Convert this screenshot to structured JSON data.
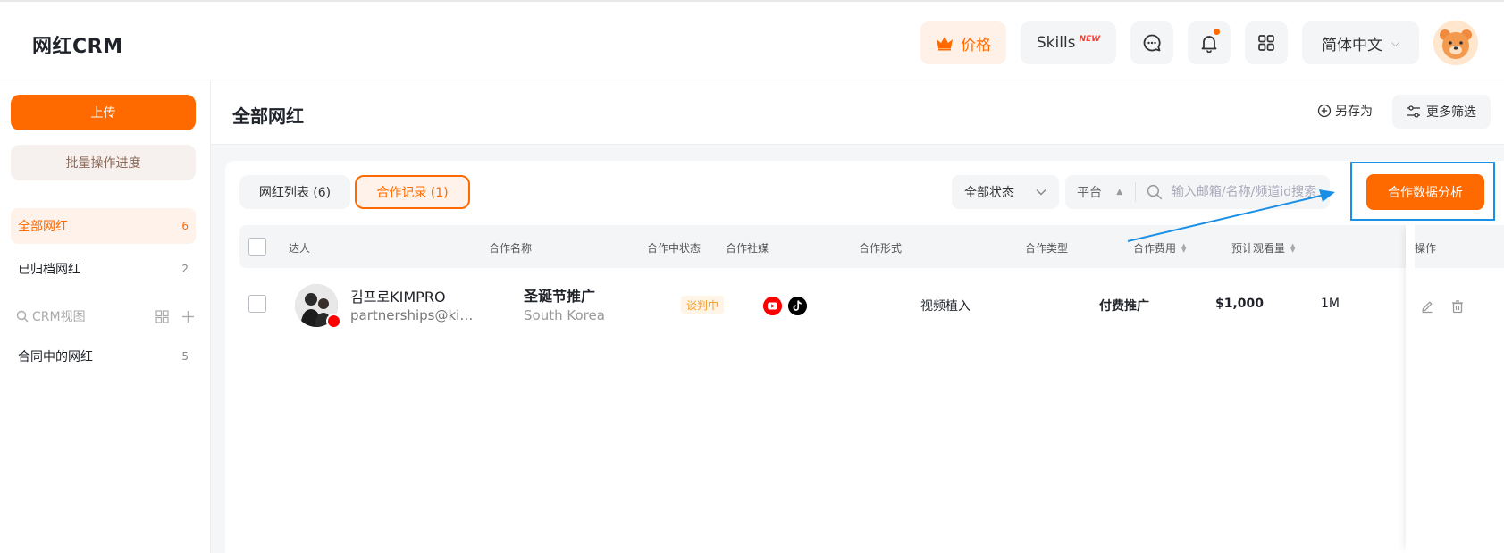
{
  "app": {
    "title": "网红CRM"
  },
  "topbar": {
    "price_label": "价格",
    "skills_label": "Skills",
    "skills_badge": "NEW",
    "language": "简体中文"
  },
  "sidebar": {
    "upload_label": "上传",
    "batch_label": "批量操作进度",
    "items": [
      {
        "label": "全部网红",
        "count": "6"
      },
      {
        "label": "已归档网红",
        "count": "2"
      }
    ],
    "view_label": "CRM视图",
    "view_items": [
      {
        "label": "合同中的网红",
        "count": "5"
      }
    ]
  },
  "main": {
    "page_title": "全部网红",
    "save_as": "另存为",
    "more_filters": "更多筛选",
    "tabs": [
      {
        "label": "网红列表 (6)"
      },
      {
        "label": "合作记录 (1)"
      }
    ],
    "status_filter": "全部状态",
    "platform_filter": "平台",
    "search_placeholder": "输入邮箱/名称/频道id搜索",
    "analysis_button": "合作数据分析"
  },
  "table": {
    "columns": [
      "达人",
      "合作名称",
      "合作中状态",
      "合作社媒",
      "合作形式",
      "合作类型",
      "合作费用",
      "预计观看量",
      "操作"
    ],
    "rows": [
      {
        "name": "김프로KIMPRO",
        "email": "partnerships@kimpro.com",
        "coop_name": "圣诞节推广",
        "region": "South Korea",
        "status": "谈判中",
        "format": "视频植入",
        "type": "付费推广",
        "fee": "$1,000",
        "views": "1M"
      }
    ]
  },
  "colors": {
    "accent": "#ff6a00",
    "highlight": "#1a8fe6"
  }
}
